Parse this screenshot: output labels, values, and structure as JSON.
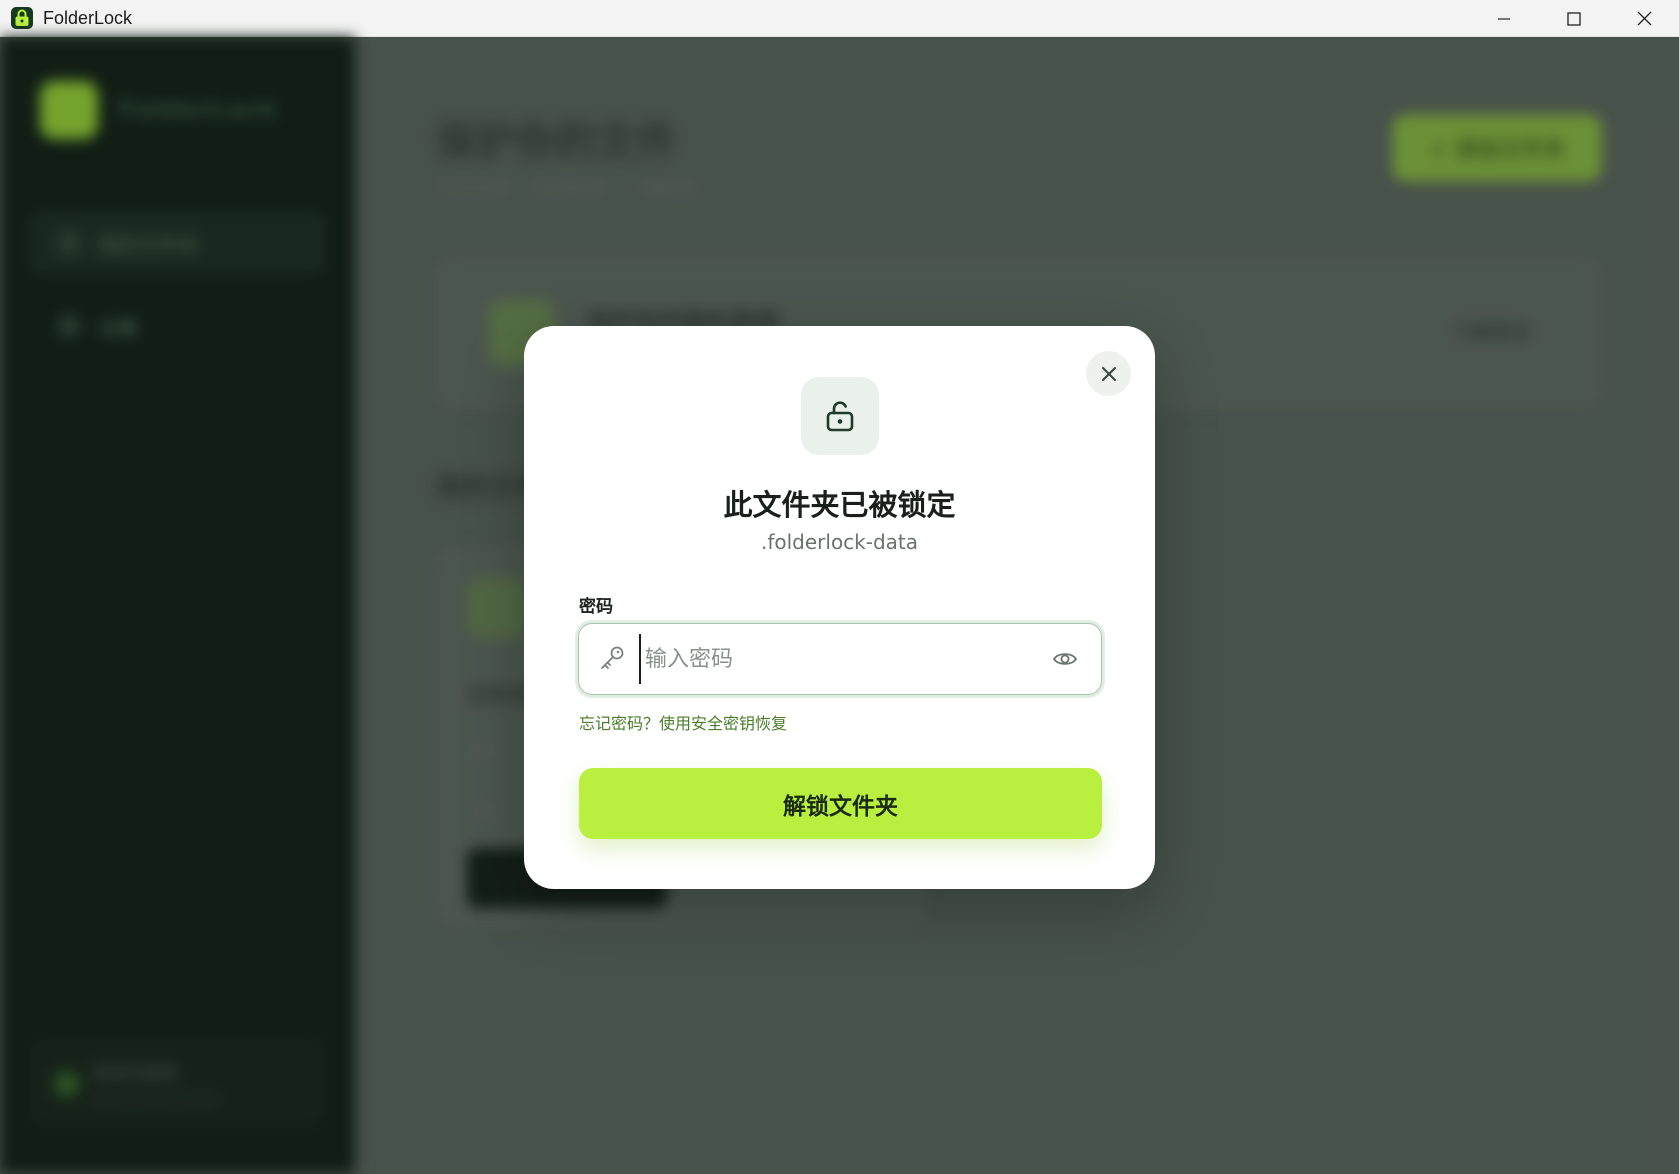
{
  "window": {
    "title": "FolderLock",
    "controls": [
      "minimize",
      "maximize",
      "close"
    ]
  },
  "background_app": {
    "sidebar": {
      "app_name": "FolderLock",
      "items": [
        {
          "label": "我的文件夹",
          "active": true
        },
        {
          "label": "设置",
          "active": false
        }
      ],
      "footer": {
        "line1": "安全已启用",
        "line2": "所有文件夹均已加密"
      }
    },
    "main": {
      "title": "保护你的文件",
      "subtitle": "安全加密 · 本地存储 · 一键锁定",
      "add_button_label": "+ 添加文件夹",
      "card_title": "保护你的隐私数据",
      "card_action": "了解更多",
      "section_title": "我的文件夹",
      "folder_card": {
        "name": "文件夹",
        "path": "路径",
        "date": "日期"
      }
    }
  },
  "modal": {
    "title": "此文件夹已被锁定",
    "subtitle": ".folderlock-data",
    "password_label": "密码",
    "password_placeholder": "输入密码",
    "password_value": "",
    "forgot_link": "忘记密码？使用安全密钥恢复",
    "unlock_button": "解锁文件夹",
    "icons": {
      "close": "close-icon",
      "lock": "unlock-icon",
      "key": "key-icon",
      "visibility": "eye-icon"
    }
  },
  "colors": {
    "accent": "#b9ef3f",
    "link": "#4a7d2a",
    "sidebar_bg": "#0c1a11",
    "lock_badge_bg": "#e9f1ea",
    "icon_dark": "#1e3a28"
  }
}
